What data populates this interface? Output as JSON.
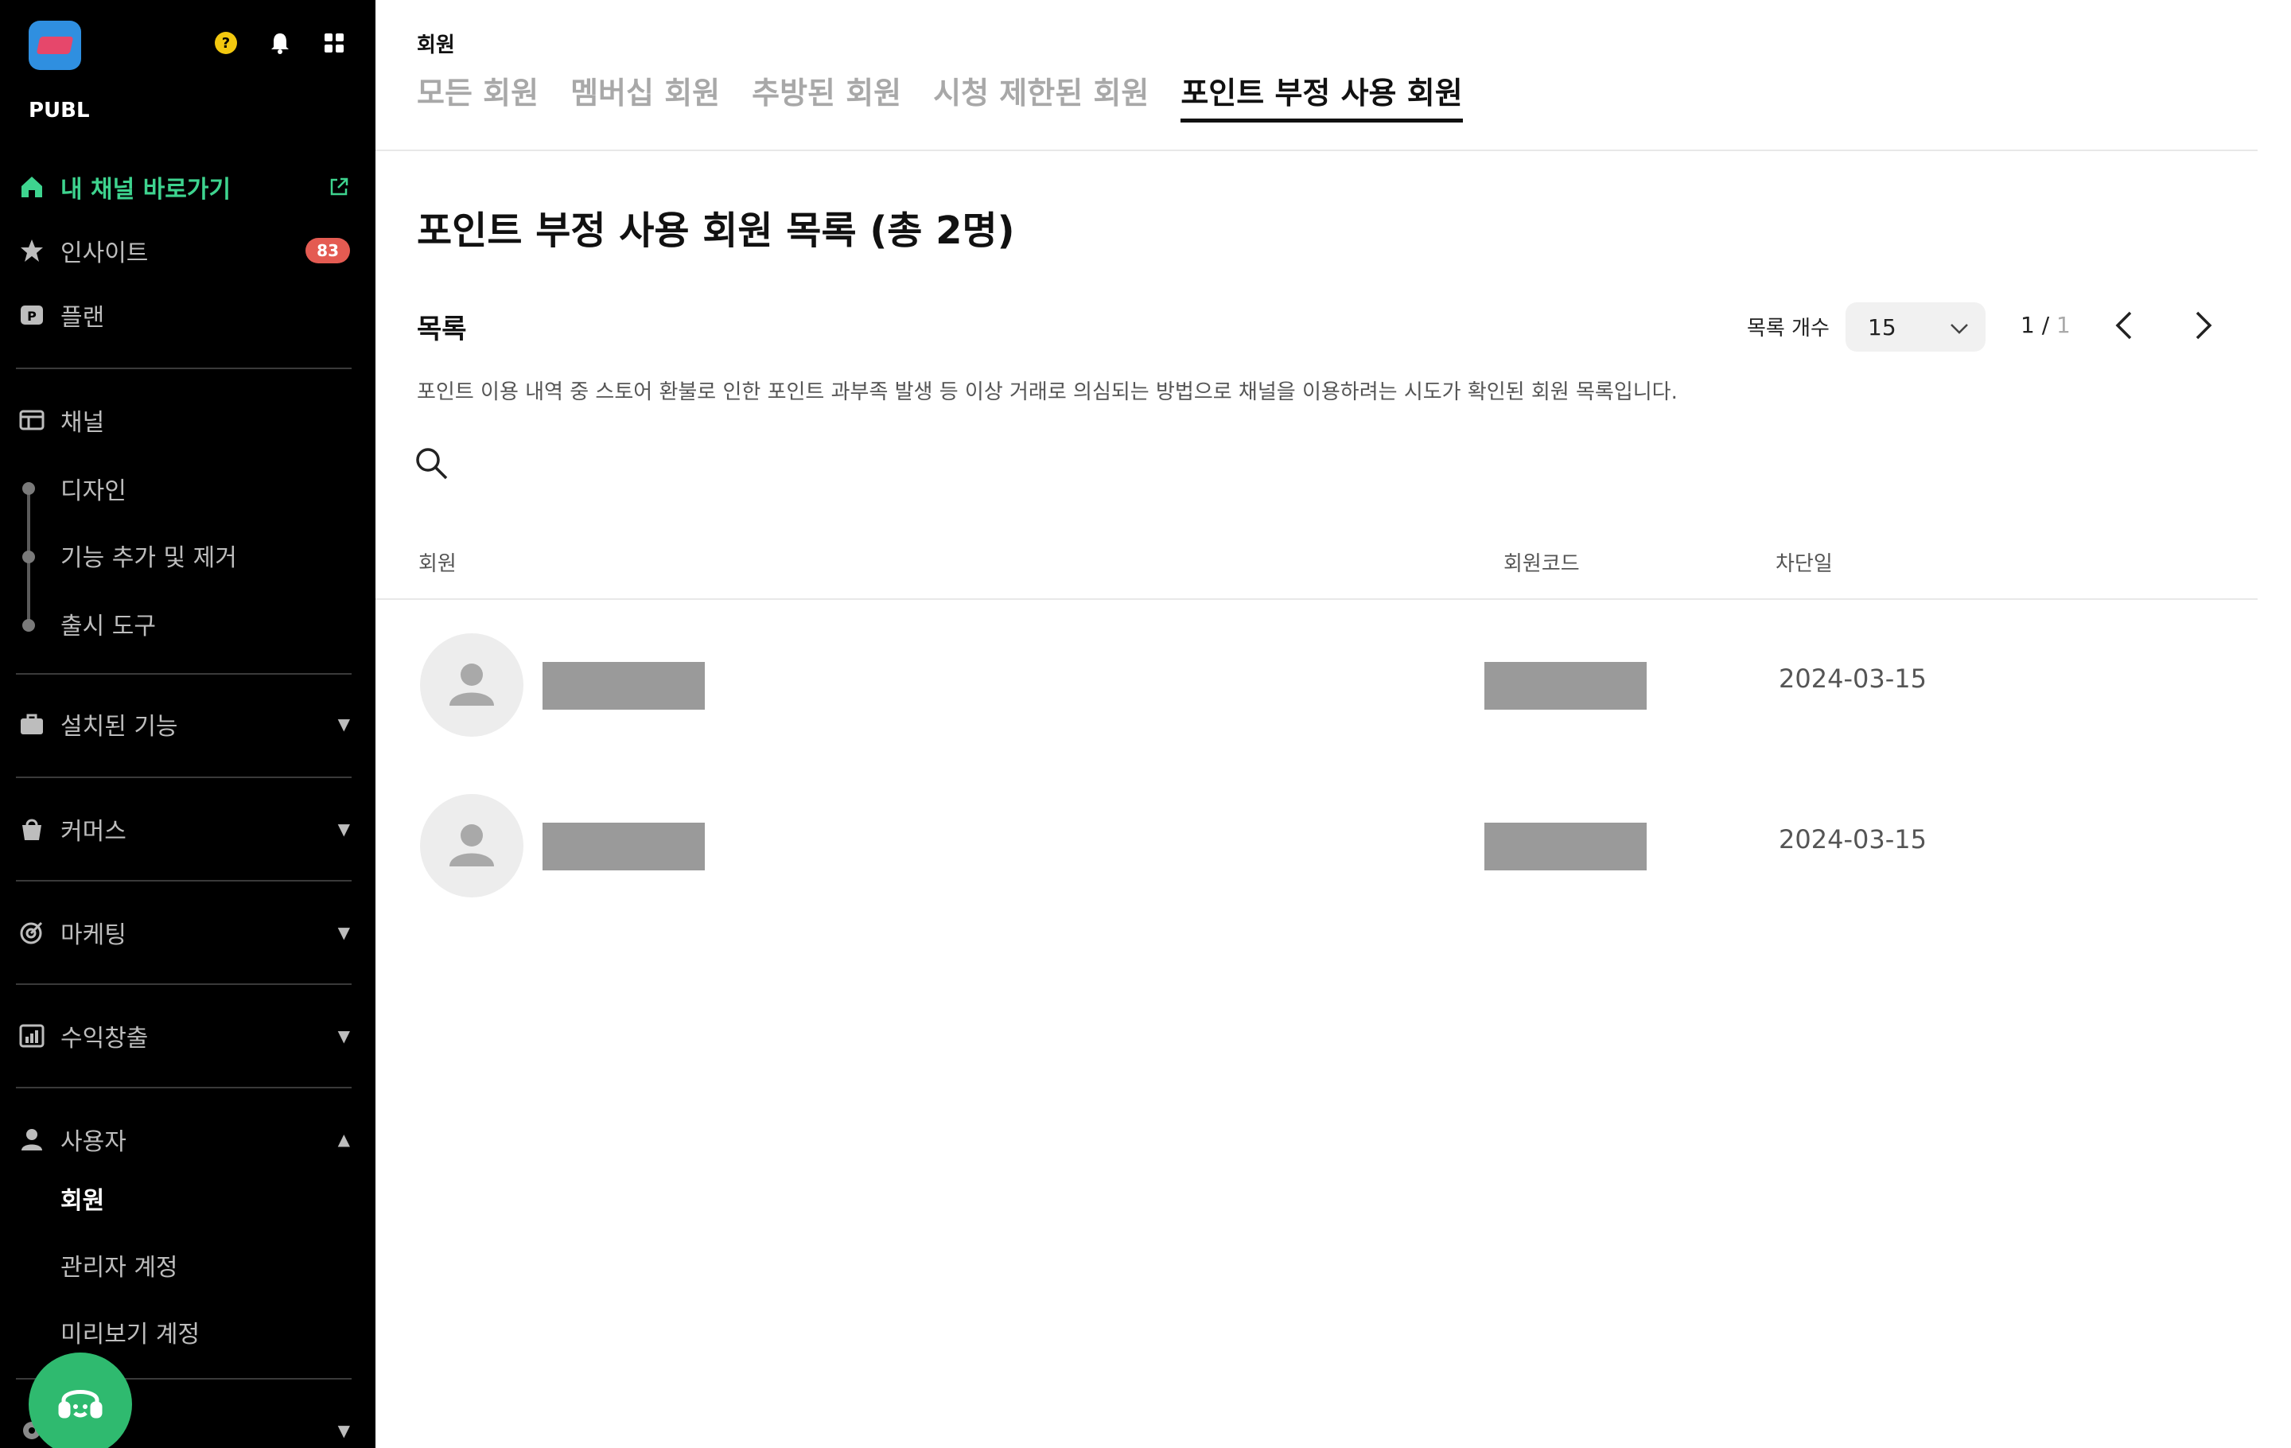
{
  "sidebar": {
    "brand": "PUBL",
    "items": [
      {
        "label": "내 채널 바로가기",
        "icon": "home-icon",
        "active": true
      },
      {
        "label": "인사이트",
        "icon": "star-icon",
        "badge": "83"
      },
      {
        "label": "플랜",
        "icon": "plan-p-icon"
      },
      {
        "label": "채널",
        "icon": "channel-icon"
      },
      {
        "label": "디자인"
      },
      {
        "label": "기능 추가 및 제거"
      },
      {
        "label": "출시 도구"
      },
      {
        "label": "설치된 기능",
        "icon": "briefcase-icon"
      },
      {
        "label": "커머스",
        "icon": "bag-icon"
      },
      {
        "label": "마케팅",
        "icon": "target-icon"
      },
      {
        "label": "수익창출",
        "icon": "chart-icon"
      },
      {
        "label": "사용자",
        "icon": "user-icon"
      },
      {
        "label": "회원"
      },
      {
        "label": "관리자 계정"
      },
      {
        "label": "미리보기 계정"
      }
    ]
  },
  "header": {
    "breadcrumb": "회원",
    "tabs": [
      {
        "label": "모든 회원"
      },
      {
        "label": "멤버십 회원"
      },
      {
        "label": "추방된 회원"
      },
      {
        "label": "시청 제한된 회원"
      },
      {
        "label": "포인트 부정 사용 회원",
        "active": true
      }
    ]
  },
  "main": {
    "title": "포인트 부정 사용 회원 목록 (총 2명)",
    "section_title": "목록",
    "description": "포인트 이용 내역 중 스토어 환불로 인한 포인트 과부족 발생 등 이상 거래로 의심되는 방법으로 채널을 이용하려는 시도가 확인된 회원 목록입니다.",
    "list_count_label": "목록 개수",
    "list_count_value": "15",
    "page_current": "1 /",
    "page_total": " 1",
    "columns": [
      "회원",
      "회원코드",
      "차단일"
    ],
    "rows": [
      {
        "date": "2024-03-15"
      },
      {
        "date": "2024-03-15"
      }
    ]
  },
  "colors": {
    "accent_green": "#3ed48f",
    "badge_red": "#e45b52",
    "fab_green": "#2fba6f",
    "logo_blue": "#2f8fe0"
  }
}
